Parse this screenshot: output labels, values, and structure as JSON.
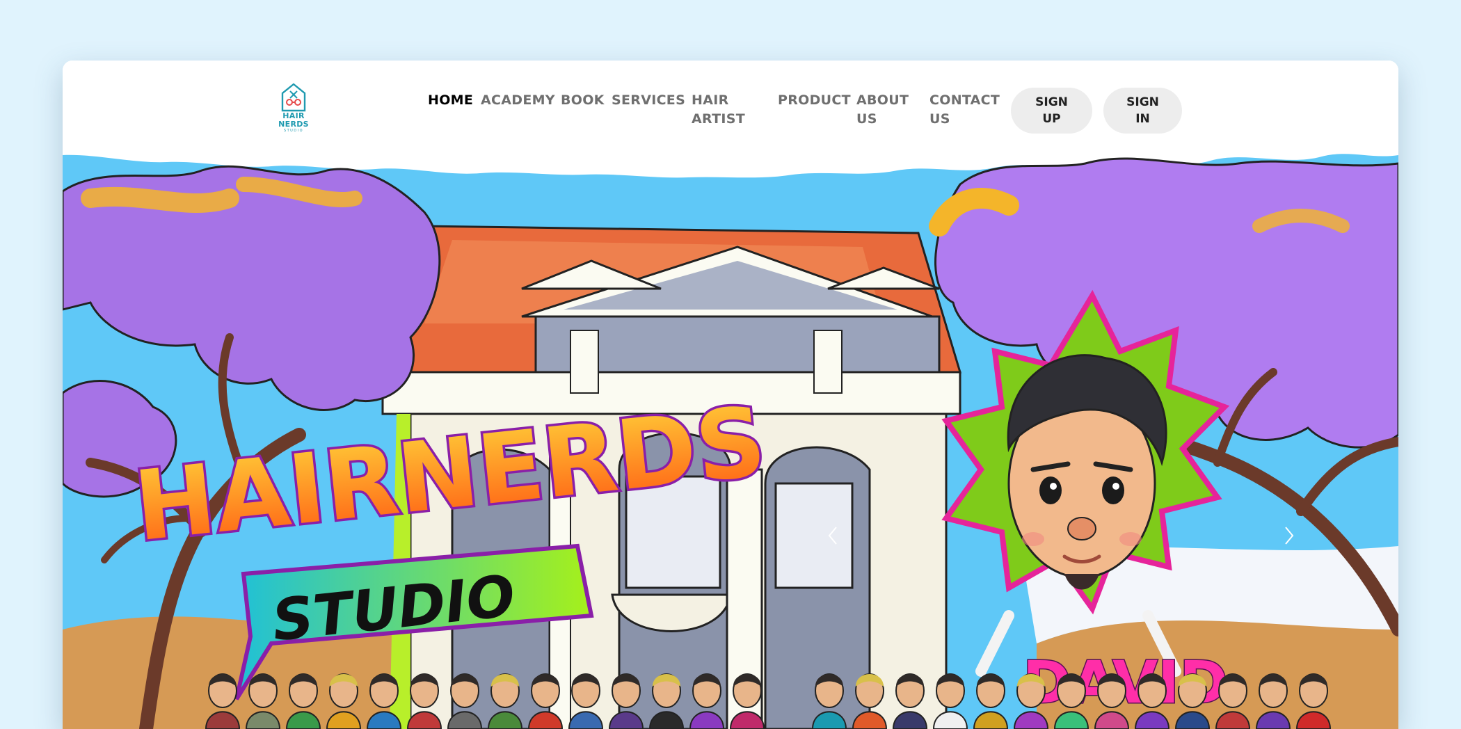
{
  "logo": {
    "line1": "HAIR",
    "line2": "NERDS",
    "line3": "STUDIO"
  },
  "nav": {
    "home": "HOME",
    "academy": "ACADEMY",
    "book": "BOOK",
    "services": "SERVICES",
    "hair_artist": "HAIR ARTIST",
    "product": "PRODUCT",
    "about_us": "ABOUT US",
    "contact_us": "CONTACT US"
  },
  "auth": {
    "sign_up": "SIGN UP",
    "sign_in": "SIGN IN"
  },
  "hero": {
    "title_word1": "HAIRNERDS",
    "title_word2": "STUDIO",
    "artist_name": "DAVID",
    "prev_icon": "chevron-left-icon",
    "next_icon": "chevron-right-icon"
  },
  "colors": {
    "page_bg": "#e0f3fd",
    "nav_active": "#000000",
    "nav_text": "#6f6f6f",
    "button_bg": "#ededed",
    "sky": "#5fc8f7",
    "tree_purple": "#b07cf0",
    "accent_green": "#7fcb1a",
    "accent_pink": "#e6249a",
    "title_orange": "#ff7a1a"
  }
}
